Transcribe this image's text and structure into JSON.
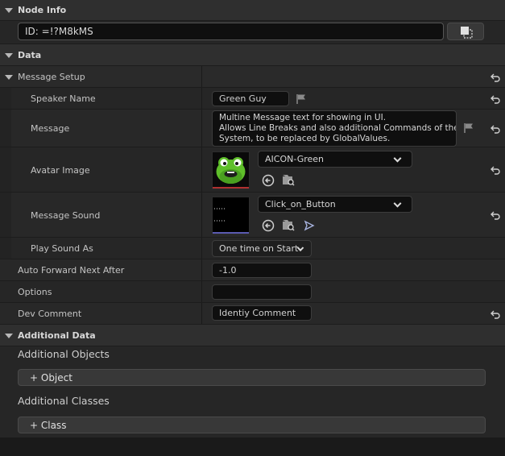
{
  "node_info": {
    "header": "Node Info",
    "id_value": "ID: =!?M8kMS"
  },
  "data": {
    "header": "Data",
    "message_setup": {
      "header": "Message Setup",
      "speaker_name": {
        "label": "Speaker Name",
        "value": "Green Guy"
      },
      "message": {
        "label": "Message",
        "lines": [
          "Multine Message text for showing in UI.",
          "Allows Line Breaks and also additional Commands of the",
          "System, to be replaced by GlobalValues."
        ]
      },
      "avatar_image": {
        "label": "Avatar Image",
        "asset": "AICON-Green"
      },
      "message_sound": {
        "label": "Message Sound",
        "asset": "Click_on_Button"
      },
      "play_sound_as": {
        "label": "Play Sound As",
        "value": "One time on Start"
      }
    },
    "auto_forward": {
      "label": "Auto Forward Next After",
      "value": "-1.0"
    },
    "options": {
      "label": "Options",
      "value": ""
    },
    "dev_comment": {
      "label": "Dev Comment",
      "value": "Identiy Comment"
    }
  },
  "additional_data": {
    "header": "Additional Data",
    "objects": {
      "label": "Additional Objects",
      "button": "+ Object"
    },
    "classes": {
      "label": "Additional Classes",
      "button": "+ Class"
    }
  },
  "colors": {
    "panel": "#262626",
    "header": "#2f2f2f",
    "field": "#0f0f0f",
    "avatar_bar": "#b03030",
    "sound_bar": "#5a5ab0"
  },
  "icons": [
    "reset-arrow-icon",
    "flag-icon",
    "browse-icon",
    "use-selected-icon",
    "play-icon",
    "chevron-down-icon",
    "picker-icon"
  ]
}
